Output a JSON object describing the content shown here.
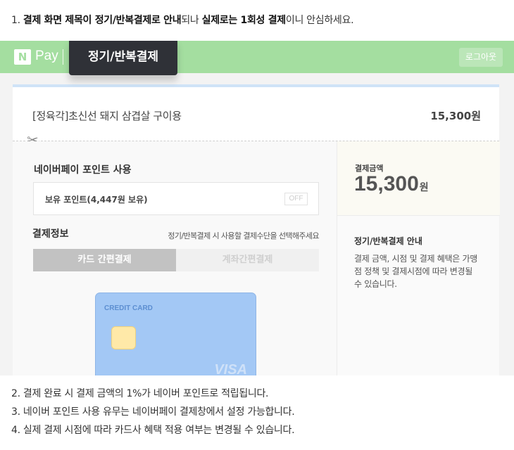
{
  "notes": {
    "n1_prefix": "1. ",
    "n1_bold1": "결제 화면 제목이 정기/반복결제로 안내",
    "n1_text1": "되나 ",
    "n1_bold2": "실제로는 1회성 결제",
    "n1_text2": "이니 안심하세요.",
    "n2": "2. 결제 완료 시 결제 금액의 1%가 네이버 포인트로 적립됩니다.",
    "n3": "3. 네이버 포인트 사용 유무는 네이버페이 결제창에서 설정 가능합니다.",
    "n4": "4. 실제 결제 시점에 따라 카드사 혜택 적용 여부는 변경될 수 있습니다."
  },
  "header": {
    "logo_n": "N",
    "logo_pay": "Pay",
    "title_tab": "정기/반복결제",
    "logout": "로그아웃"
  },
  "product": {
    "name": "[정육각]초신선 돼지 삼겹살 구이용",
    "price": "15,300원"
  },
  "points": {
    "title": "네이버페이 포인트 사용",
    "owned": "보유 포인트(4,447원 보유)",
    "toggle": "OFF"
  },
  "payment": {
    "title": "결제정보",
    "hint": "정기/반복결제 시 사용할 결제수단을 선택해주세요",
    "tab_card": "카드 간편결제",
    "tab_bank": "계좌간편결제",
    "card_label": "CREDIT CARD",
    "card_brand": "VISA"
  },
  "summary": {
    "amount_label": "결제금액",
    "amount_value": "15,300",
    "amount_unit": "원",
    "guide_title": "정기/반복결제 안내",
    "guide_text": "결제 금액, 시점 및 결제 혜택은 가맹점 정책 및 결제시점에 따라 변경될 수 있습니다."
  },
  "icons": {
    "scissors": "✂"
  },
  "colors": {
    "brand_green": "#a4dea0",
    "tab_dark": "#2f3137",
    "card_blue": "#a3c8f5"
  }
}
